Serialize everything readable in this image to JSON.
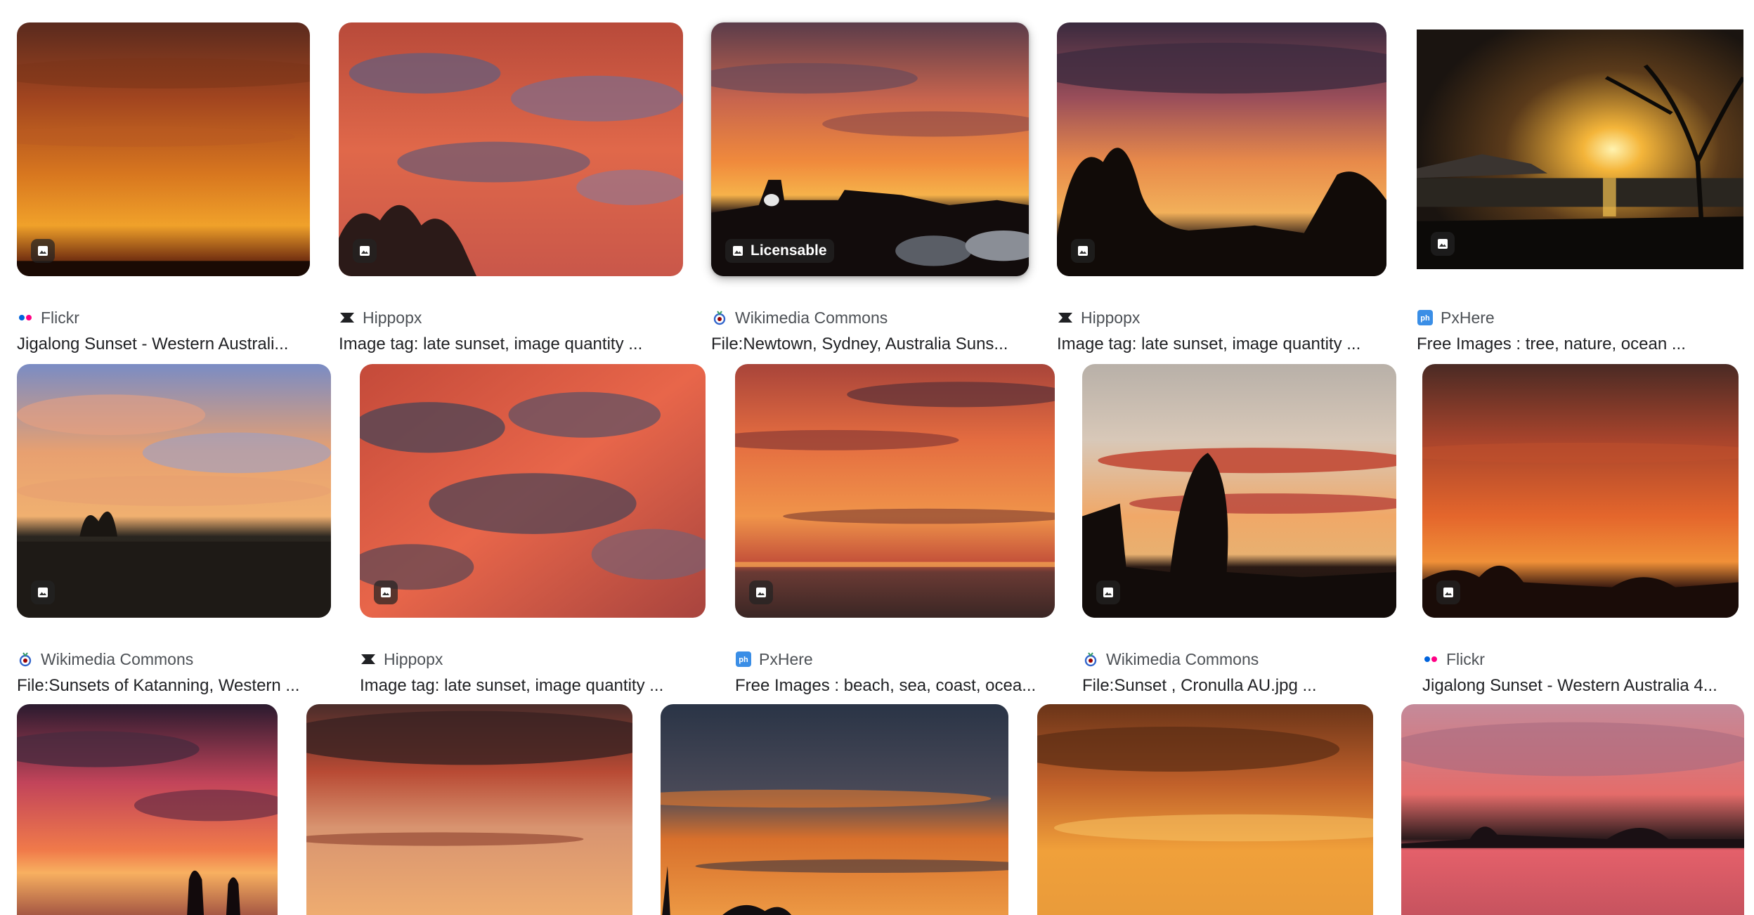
{
  "results": [
    {
      "source": "Flickr",
      "source_icon": "flickr-icon",
      "title": "Jigalong Sunset - Western Australi..."
    },
    {
      "source": "Hippopx",
      "source_icon": "hippopx-icon",
      "title": "Image tag: late sunset, image quantity ..."
    },
    {
      "source": "Wikimedia Commons",
      "source_icon": "wikimedia-icon",
      "title": "File:Newtown, Sydney, Australia Suns...",
      "badge": "Licensable"
    },
    {
      "source": "Hippopx",
      "source_icon": "hippopx-icon",
      "title": "Image tag: late sunset, image quantity ..."
    },
    {
      "source": "PxHere",
      "source_icon": "pxhere-icon",
      "title": "Free Images : tree, nature, ocean ..."
    },
    {
      "source": "Wikimedia Commons",
      "source_icon": "wikimedia-icon",
      "title": "File:Sunsets of Katanning, Western ..."
    },
    {
      "source": "Hippopx",
      "source_icon": "hippopx-icon",
      "title": "Image tag: late sunset, image quantity ..."
    },
    {
      "source": "PxHere",
      "source_icon": "pxhere-icon",
      "title": "Free Images : beach, sea, coast, ocea..."
    },
    {
      "source": "Wikimedia Commons",
      "source_icon": "wikimedia-icon",
      "title": "File:Sunset , Cronulla AU.jpg ..."
    },
    {
      "source": "Flickr",
      "source_icon": "flickr-icon",
      "title": "Jigalong Sunset - Western Australia 4..."
    },
    {
      "source": "",
      "source_icon": "",
      "title": ""
    },
    {
      "source": "",
      "source_icon": "",
      "title": ""
    },
    {
      "source": "",
      "source_icon": "",
      "title": ""
    },
    {
      "source": "",
      "source_icon": "",
      "title": ""
    },
    {
      "source": "",
      "source_icon": "",
      "title": ""
    }
  ],
  "colors": {
    "source_text": "#4d5156",
    "title_text": "#202124",
    "flickr_blue": "#0063dc",
    "flickr_pink": "#ff0084",
    "pxhere_blue": "#3a8ee6",
    "wikimedia_blue": "#3366cc"
  }
}
